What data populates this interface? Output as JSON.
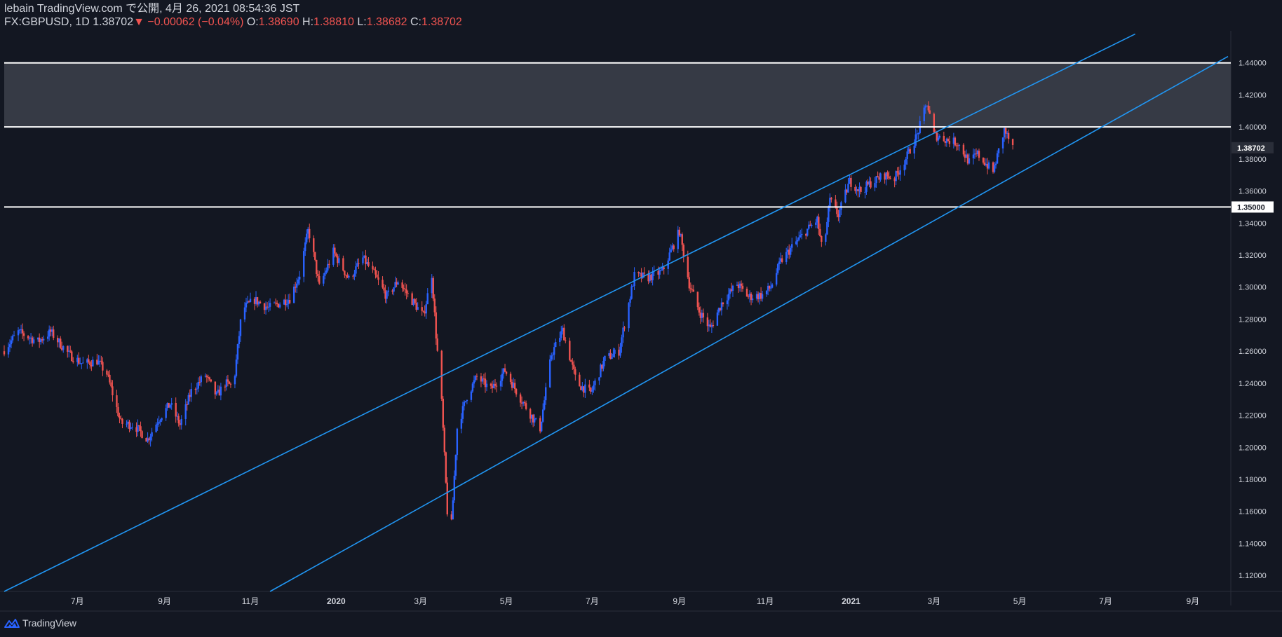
{
  "header": {
    "line1": "lebain TradingView.com で公開, 4月 26, 2021 08:54:36 JST",
    "symbol": "FX:GBPUSD, 1D",
    "last": "1.38702",
    "arrow": "▼",
    "change": "−0.00062 (−0.04%)",
    "o_label": "O:",
    "o_value": "1.38690",
    "h_label": "H:",
    "h_value": "1.38810",
    "l_label": "L:",
    "l_value": "1.38682",
    "c_label": "C:",
    "c_value": "1.38702"
  },
  "footer": {
    "brand": "TradingView",
    "logo_icon": "tradingview-logo-icon"
  },
  "colors": {
    "background": "#131722",
    "up": "#2962ff",
    "down": "#ef5350",
    "channel": "#2196f3",
    "level": "#ffffff",
    "zone": "#363a45",
    "axis_text": "#d1d4dc"
  },
  "chart_data": {
    "type": "candlestick",
    "symbol": "FX:GBPUSD",
    "interval": "1D",
    "ylim": [
      1.11,
      1.46
    ],
    "y_ticks": [
      "1.12000",
      "1.14000",
      "1.16000",
      "1.18000",
      "1.20000",
      "1.22000",
      "1.24000",
      "1.26000",
      "1.28000",
      "1.30000",
      "1.32000",
      "1.34000",
      "1.36000",
      "1.38000",
      "1.40000",
      "1.42000",
      "1.44000"
    ],
    "x_ticks": [
      {
        "date": "2019-07-01",
        "label": "7月"
      },
      {
        "date": "2019-09-01",
        "label": "9月"
      },
      {
        "date": "2019-11-01",
        "label": "11月"
      },
      {
        "date": "2020-01-01",
        "label": "2020"
      },
      {
        "date": "2020-03-01",
        "label": "3月"
      },
      {
        "date": "2020-05-01",
        "label": "5月"
      },
      {
        "date": "2020-07-01",
        "label": "7月"
      },
      {
        "date": "2020-09-01",
        "label": "9月"
      },
      {
        "date": "2020-11-01",
        "label": "11月"
      },
      {
        "date": "2021-01-01",
        "label": "2021"
      },
      {
        "date": "2021-03-01",
        "label": "3月"
      },
      {
        "date": "2021-05-01",
        "label": "5月"
      },
      {
        "date": "2021-07-01",
        "label": "7月"
      },
      {
        "date": "2021-09-01",
        "label": "9月"
      }
    ],
    "x_range": [
      "2019-05-10",
      "2021-09-28"
    ],
    "horizontal_levels": [
      {
        "price": 1.44,
        "label": ""
      },
      {
        "price": 1.4,
        "label": ""
      },
      {
        "price": 1.35,
        "label": "1.35000"
      }
    ],
    "zone": [
      1.4,
      1.44
    ],
    "current_price": {
      "price": 1.38702,
      "label": "1.38702"
    },
    "channel_lines": [
      {
        "p1": {
          "date": "2019-05-10",
          "price": 1.11
        },
        "p2": {
          "date": "2021-07-22",
          "price": 1.458
        }
      },
      {
        "p1": {
          "date": "2019-11-15",
          "price": 1.11
        },
        "p2": {
          "date": "2021-09-26",
          "price": 1.444
        }
      }
    ],
    "price_path": [
      [
        "2019-05-10",
        1.261
      ],
      [
        "2019-05-20",
        1.272
      ],
      [
        "2019-06-03",
        1.266
      ],
      [
        "2019-06-12",
        1.272
      ],
      [
        "2019-06-25",
        1.258
      ],
      [
        "2019-07-05",
        1.252
      ],
      [
        "2019-07-15",
        1.254
      ],
      [
        "2019-07-22",
        1.246
      ],
      [
        "2019-08-01",
        1.215
      ],
      [
        "2019-08-10",
        1.214
      ],
      [
        "2019-08-20",
        1.205
      ],
      [
        "2019-08-28",
        1.218
      ],
      [
        "2019-09-05",
        1.227
      ],
      [
        "2019-09-12",
        1.214
      ],
      [
        "2019-09-20",
        1.235
      ],
      [
        "2019-09-30",
        1.245
      ],
      [
        "2019-10-08",
        1.232
      ],
      [
        "2019-10-14",
        1.24
      ],
      [
        "2019-10-20",
        1.238
      ],
      [
        "2019-10-26",
        1.286
      ],
      [
        "2019-11-04",
        1.292
      ],
      [
        "2019-11-14",
        1.287
      ],
      [
        "2019-11-22",
        1.29
      ],
      [
        "2019-11-29",
        1.293
      ],
      [
        "2019-12-06",
        1.308
      ],
      [
        "2019-12-12",
        1.335
      ],
      [
        "2019-12-14",
        1.33
      ],
      [
        "2019-12-20",
        1.3
      ],
      [
        "2019-12-30",
        1.322
      ],
      [
        "2020-01-10",
        1.305
      ],
      [
        "2020-01-20",
        1.318
      ],
      [
        "2020-01-28",
        1.308
      ],
      [
        "2020-02-06",
        1.294
      ],
      [
        "2020-02-14",
        1.304
      ],
      [
        "2020-02-22",
        1.294
      ],
      [
        "2020-03-03",
        1.282
      ],
      [
        "2020-03-09",
        1.308
      ],
      [
        "2020-03-12",
        1.27
      ],
      [
        "2020-03-16",
        1.228
      ],
      [
        "2020-03-20",
        1.16
      ],
      [
        "2020-03-23",
        1.152
      ],
      [
        "2020-03-27",
        1.212
      ],
      [
        "2020-04-03",
        1.232
      ],
      [
        "2020-04-10",
        1.244
      ],
      [
        "2020-04-20",
        1.236
      ],
      [
        "2020-04-30",
        1.248
      ],
      [
        "2020-05-10",
        1.232
      ],
      [
        "2020-05-20",
        1.218
      ],
      [
        "2020-05-25",
        1.212
      ],
      [
        "2020-06-02",
        1.258
      ],
      [
        "2020-06-10",
        1.273
      ],
      [
        "2020-06-20",
        1.24
      ],
      [
        "2020-06-30",
        1.234
      ],
      [
        "2020-07-10",
        1.255
      ],
      [
        "2020-07-20",
        1.26
      ],
      [
        "2020-07-31",
        1.307
      ],
      [
        "2020-08-10",
        1.306
      ],
      [
        "2020-08-20",
        1.31
      ],
      [
        "2020-09-01",
        1.335
      ],
      [
        "2020-09-08",
        1.302
      ],
      [
        "2020-09-15",
        1.285
      ],
      [
        "2020-09-23",
        1.274
      ],
      [
        "2020-10-01",
        1.29
      ],
      [
        "2020-10-12",
        1.302
      ],
      [
        "2020-10-20",
        1.294
      ],
      [
        "2020-10-30",
        1.295
      ],
      [
        "2020-11-05",
        1.3
      ],
      [
        "2020-11-12",
        1.316
      ],
      [
        "2020-11-20",
        1.325
      ],
      [
        "2020-11-30",
        1.335
      ],
      [
        "2020-12-08",
        1.342
      ],
      [
        "2020-12-12",
        1.32
      ],
      [
        "2020-12-17",
        1.354
      ],
      [
        "2020-12-23",
        1.345
      ],
      [
        "2020-12-31",
        1.366
      ],
      [
        "2021-01-08",
        1.36
      ],
      [
        "2021-01-15",
        1.365
      ],
      [
        "2021-01-25",
        1.37
      ],
      [
        "2021-02-01",
        1.368
      ],
      [
        "2021-02-10",
        1.382
      ],
      [
        "2021-02-17",
        1.395
      ],
      [
        "2021-02-24",
        1.415
      ],
      [
        "2021-03-01",
        1.395
      ],
      [
        "2021-03-10",
        1.392
      ],
      [
        "2021-03-18",
        1.39
      ],
      [
        "2021-03-26",
        1.378
      ],
      [
        "2021-04-01",
        1.383
      ],
      [
        "2021-04-08",
        1.376
      ],
      [
        "2021-04-12",
        1.372
      ],
      [
        "2021-04-20",
        1.398
      ],
      [
        "2021-04-26",
        1.387
      ]
    ]
  }
}
